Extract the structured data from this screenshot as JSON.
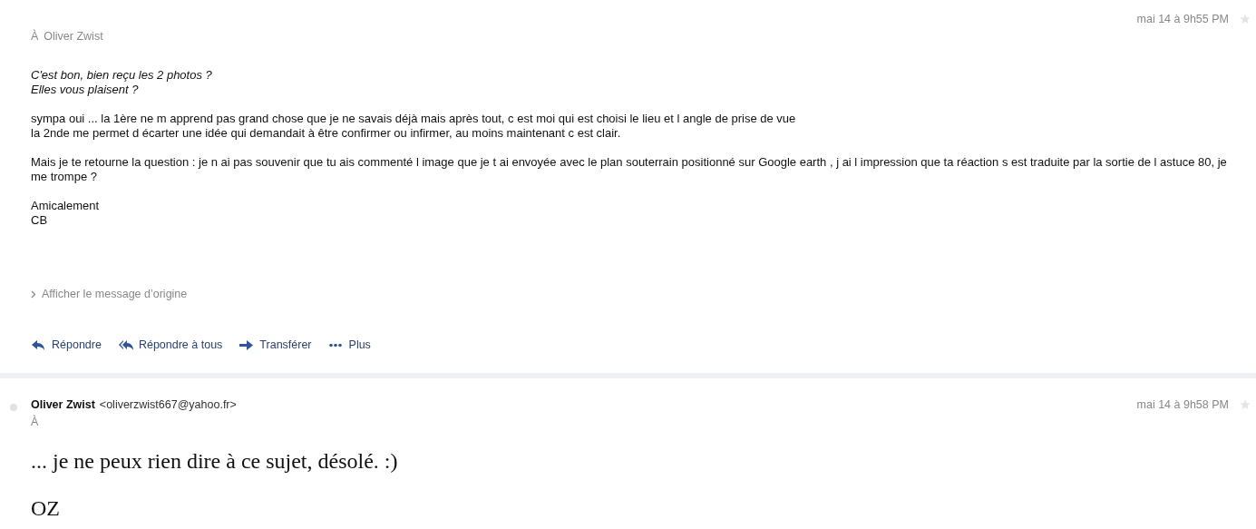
{
  "messages": [
    {
      "to_label": "À",
      "to": "Oliver Zwist",
      "date": "mai 14 à 9h55 PM",
      "starred": false,
      "unread_dot": false,
      "kind": "plain",
      "paragraphs": [
        [
          "*C'est bon, bien reçu les 2 photos ?*",
          "*Elles vous plaisent ?*"
        ],
        [
          "sympa oui ... la 1ère ne m apprend pas grand chose que je ne savais déjà mais après tout, c est moi qui est choisi le lieu et l angle de prise de vue",
          "la 2nde me permet d écarter une idée qui demandait à être confirmer ou infirmer, au moins maintenant c est clair."
        ],
        [
          "Mais je te retourne la question : je n ai pas souvenir que tu ais commenté l image que je t ai envoyée avec le plan souterrain positionné sur Google earth , j ai l impression que ta réaction s est traduite par la sortie de l astuce 80, je me trompe ?"
        ],
        [
          "Amicalement",
          "CB"
        ]
      ],
      "show_original": "Afficher le message d’origine",
      "actions": [
        {
          "kind": "reply",
          "label": "Répondre"
        },
        {
          "kind": "reply_all",
          "label": "Répondre à tous"
        },
        {
          "kind": "forward",
          "label": "Transférer"
        },
        {
          "kind": "more",
          "label": "Plus"
        }
      ]
    },
    {
      "sender_name": "Oliver Zwist",
      "sender_email": "<oliverzwist667@yahoo.fr>",
      "to_label": "À",
      "date": "mai 14 à 9h58 PM",
      "starred": false,
      "unread_dot": true,
      "kind": "large_serif",
      "paragraphs": [
        [
          "... je ne peux rien dire à ce sujet, désolé. :)"
        ],
        [
          "OZ"
        ]
      ]
    }
  ]
}
